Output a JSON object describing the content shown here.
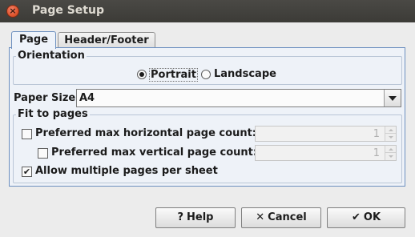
{
  "window": {
    "title": "Page Setup",
    "close_glyph": "×"
  },
  "tabs": [
    {
      "label": "Page",
      "active": true
    },
    {
      "label": "Header/Footer",
      "active": false
    }
  ],
  "orientation": {
    "label": "Orientation",
    "options": [
      {
        "label": "Portrait",
        "selected": true
      },
      {
        "label": "Landscape",
        "selected": false
      }
    ]
  },
  "paper_size": {
    "label": "Paper Size",
    "value": "A4"
  },
  "fit": {
    "label": "Fit to pages",
    "horizontal": {
      "label": "Preferred max horizontal page count:",
      "checked": false,
      "value": "1"
    },
    "vertical": {
      "label": "Preferred max vertical page count:",
      "checked": false,
      "value": "1"
    },
    "multiple": {
      "label": "Allow multiple pages per sheet",
      "checked": true,
      "check_glyph": "✔"
    }
  },
  "buttons": {
    "help": {
      "label": "Help",
      "glyph": "?"
    },
    "cancel": {
      "label": "Cancel",
      "glyph": "✕"
    },
    "ok": {
      "label": "OK",
      "glyph": "✔"
    }
  }
}
